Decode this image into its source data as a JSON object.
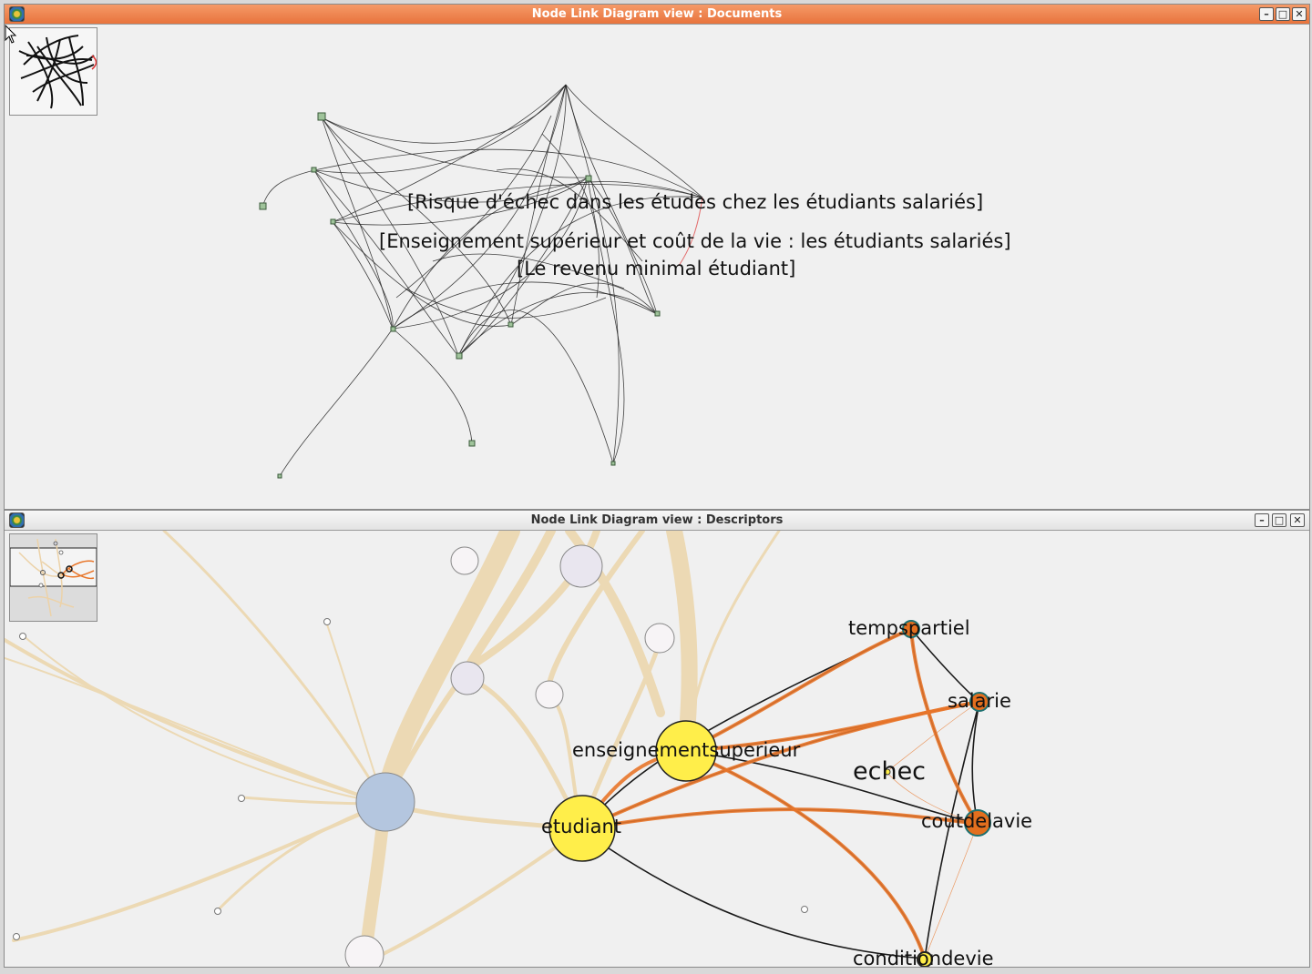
{
  "documents_window": {
    "title": "Node Link Diagram view : Documents",
    "labels": [
      "[Risque d'échec dans les études chez les étudiants salariés]",
      "[Enseignement supérieur et coût de la vie : les étudiants salariés]",
      "[Le revenu minimal étudiant]"
    ]
  },
  "descriptors_window": {
    "title": "Node Link Diagram view : Descriptors",
    "labels": {
      "tempspartiel": "tempspartiel",
      "salarie": "salarie",
      "enseignementsuperieur": "enseignementsuperieur",
      "echec": "echec",
      "etudiant": "etudiant",
      "coutdelavie": "coutdelavie",
      "conditiondevie": "conditiondevie"
    }
  },
  "window_buttons": {
    "minimize": "–",
    "maximize": "□",
    "close": "✕"
  },
  "colors": {
    "active_titlebar": "#ec7a43",
    "highlight_edge": "#e8762a",
    "faded_edge": "#ecd9b4",
    "selected_node": "#ffee4a",
    "descriptor_node": "#e36f1e",
    "blue_node": "#b4c6df",
    "doc_node": "#9fc39a"
  },
  "icons": [
    "app-icon",
    "minimize-icon",
    "maximize-icon",
    "close-icon",
    "mouse-cursor-icon"
  ]
}
